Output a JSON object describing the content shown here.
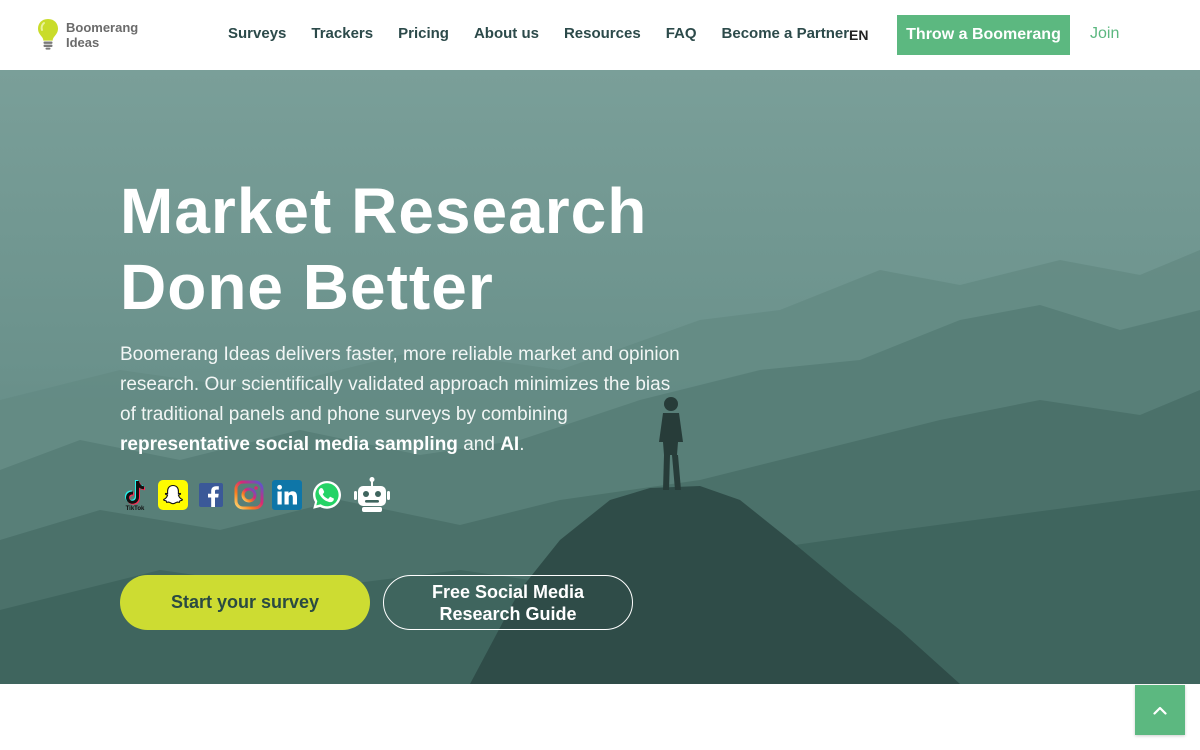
{
  "brand": {
    "name_line1": "Boomerang",
    "name_line2": "Ideas",
    "logo_icon": "lightbulb-icon"
  },
  "nav": {
    "items": [
      {
        "label": "Surveys"
      },
      {
        "label": "Trackers"
      },
      {
        "label": "Pricing"
      },
      {
        "label": "About us"
      },
      {
        "label": "Resources"
      },
      {
        "label": "FAQ"
      },
      {
        "label": "Become a Partner"
      }
    ],
    "language": "EN",
    "cta_label": "Throw a Boomerang",
    "join_label": "Join"
  },
  "hero": {
    "headline_line1": "Market Research",
    "headline_line2": "Done Better",
    "desc_part1": "Boomerang Ideas delivers faster, more reliable market and opinion research. Our scientifically validated approach minimizes the bias of traditional panels and phone surveys by combining ",
    "desc_bold1": "representative social media sampling",
    "desc_part2": " and ",
    "desc_bold2": "AI",
    "desc_part3": ".",
    "socials": [
      {
        "name": "tiktok-icon",
        "label": "TikTok"
      },
      {
        "name": "snapchat-icon"
      },
      {
        "name": "facebook-icon"
      },
      {
        "name": "instagram-icon"
      },
      {
        "name": "linkedin-icon"
      },
      {
        "name": "whatsapp-icon"
      },
      {
        "name": "robot-icon"
      }
    ],
    "primary_button": "Start your survey",
    "secondary_button_line1": "Free Social Media",
    "secondary_button_line2": "Research Guide"
  },
  "scroll_top": {
    "icon": "chevron-up-icon"
  },
  "colors": {
    "accent_green": "#5cb880",
    "lime": "#cddc32",
    "nav_text": "#2c4a4a",
    "hero_teal": "#5f8a85"
  }
}
